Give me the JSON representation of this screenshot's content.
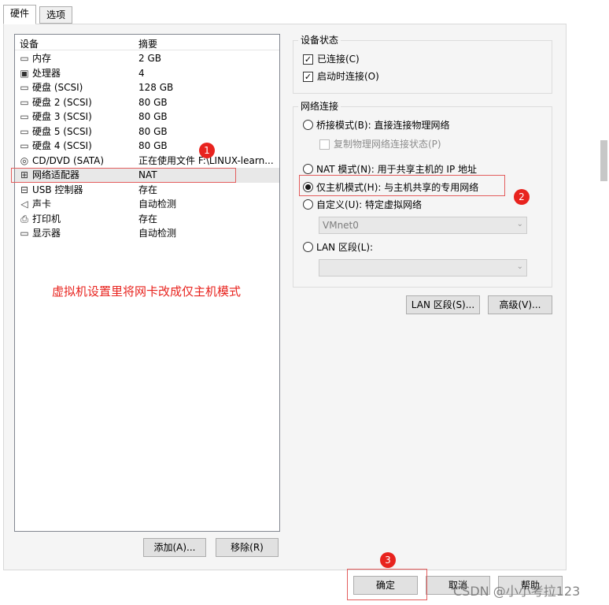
{
  "tabs": [
    "硬件",
    "选项"
  ],
  "device_list": {
    "headers": [
      "设备",
      "摘要"
    ],
    "rows": [
      {
        "icon": "memory-icon",
        "name": "内存",
        "summary": "2 GB"
      },
      {
        "icon": "processor-icon",
        "name": "处理器",
        "summary": "4"
      },
      {
        "icon": "hard-disk-icon",
        "name": "硬盘 (SCSI)",
        "summary": "128 GB"
      },
      {
        "icon": "hard-disk-icon",
        "name": "硬盘 2 (SCSI)",
        "summary": "80 GB"
      },
      {
        "icon": "hard-disk-icon",
        "name": "硬盘 3 (SCSI)",
        "summary": "80 GB"
      },
      {
        "icon": "hard-disk-icon",
        "name": "硬盘 5 (SCSI)",
        "summary": "80 GB"
      },
      {
        "icon": "hard-disk-icon",
        "name": "硬盘 4 (SCSI)",
        "summary": "80 GB"
      },
      {
        "icon": "cd-dvd-icon",
        "name": "CD/DVD (SATA)",
        "summary": "正在使用文件 F:\\LINUX-learn..."
      },
      {
        "icon": "network-adapter-icon",
        "name": "网络适配器",
        "summary": "NAT"
      },
      {
        "icon": "usb-icon",
        "name": "USB 控制器",
        "summary": "存在"
      },
      {
        "icon": "sound-card-icon",
        "name": "声卡",
        "summary": "自动检测"
      },
      {
        "icon": "printer-icon",
        "name": "打印机",
        "summary": "存在"
      },
      {
        "icon": "display-icon",
        "name": "显示器",
        "summary": "自动检测"
      }
    ],
    "add_label": "添加(A)...",
    "remove_label": "移除(R)"
  },
  "device_status": {
    "title": "设备状态",
    "connected_label": "已连接(C)",
    "connected_checked": true,
    "connect_at_power_on_label": "启动时连接(O)",
    "connect_at_power_on_checked": true
  },
  "network": {
    "title": "网络连接",
    "bridged_label": "桥接模式(B): 直接连接物理网络",
    "replicate_label": "复制物理网络连接状态(P)",
    "nat_label": "NAT 模式(N): 用于共享主机的 IP 地址",
    "host_only_label": "仅主机模式(H): 与主机共享的专用网络",
    "custom_label": "自定义(U): 特定虚拟网络",
    "custom_value": "VMnet0",
    "lan_label": "LAN 区段(L):",
    "lan_value": "",
    "selected": "host_only",
    "lan_segments_button": "LAN 区段(S)...",
    "advanced_button": "高级(V)..."
  },
  "footer": {
    "ok_label": "确定",
    "cancel_label": "取消",
    "help_label": "帮助"
  },
  "annotations": {
    "badge1": "1",
    "badge2": "2",
    "badge3": "3",
    "note": "虚拟机设置里将网卡改成仅主机模式",
    "color": "#e8231e"
  },
  "watermark": "CSDN @小小考拉123"
}
